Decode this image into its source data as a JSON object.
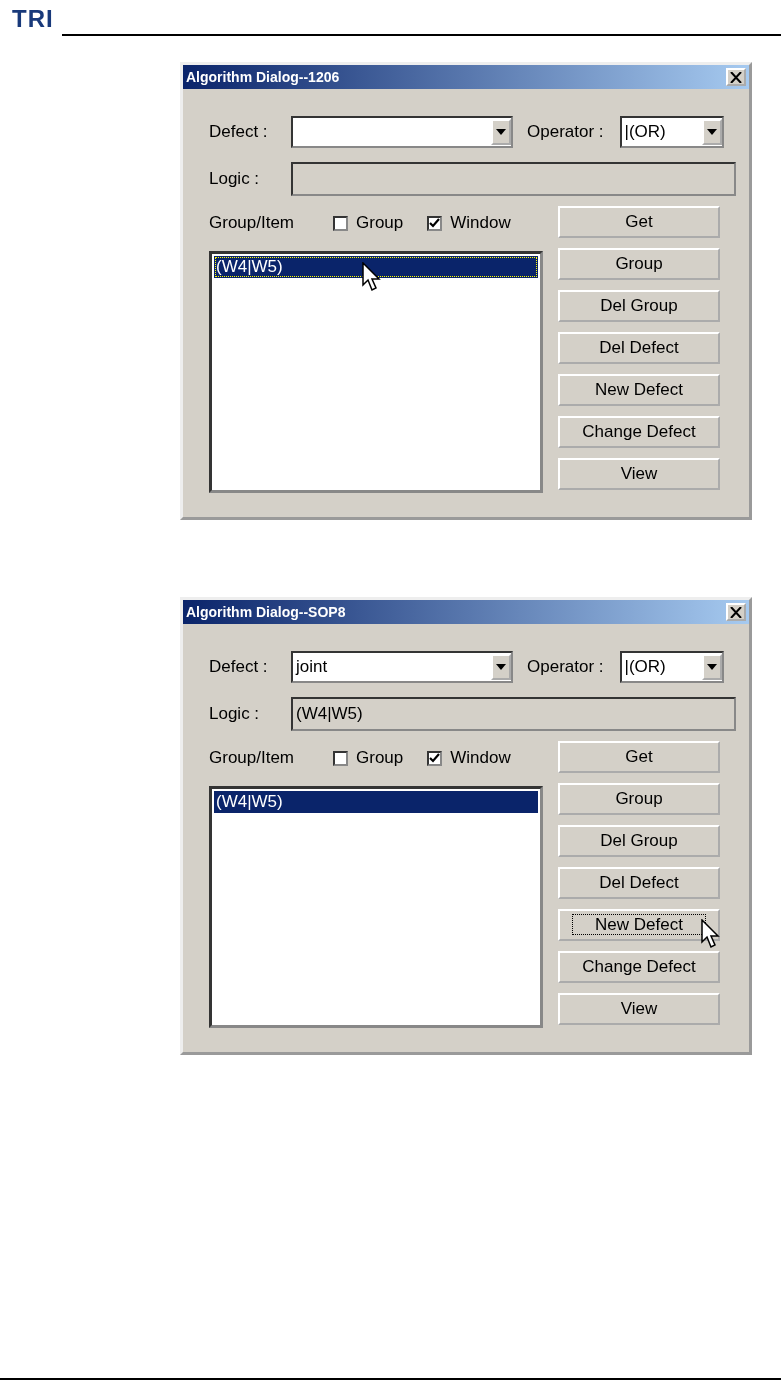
{
  "header": {
    "logo": "TRI"
  },
  "dialogs": [
    {
      "title": "Algorithm Dialog--1206",
      "defect": {
        "label": "Defect :"
      },
      "operator": {
        "label": "Operator :",
        "value": "|(OR)"
      },
      "logic": {
        "label": "Logic :"
      },
      "group_item_label": "Group/Item",
      "checkboxes": [
        {
          "label": "Group",
          "checked": false
        },
        {
          "label": "Window",
          "checked": true
        }
      ],
      "list": [
        {
          "text": "(W4|W5)",
          "selected": true,
          "focused": true,
          "pointer": true
        }
      ],
      "buttons": [
        {
          "label": "Get",
          "focused": false,
          "pointer": false
        },
        {
          "label": "Group",
          "focused": false,
          "pointer": false
        },
        {
          "label": "Del Group",
          "focused": false,
          "pointer": false
        },
        {
          "label": "Del Defect",
          "focused": false,
          "pointer": false
        },
        {
          "label": "New Defect",
          "focused": false,
          "pointer": false
        },
        {
          "label": "Change Defect",
          "focused": false,
          "pointer": false
        },
        {
          "label": "View",
          "focused": false,
          "pointer": false
        }
      ]
    },
    {
      "title": "Algorithm Dialog--SOP8",
      "defect": {
        "label": "Defect :",
        "value": "joint"
      },
      "operator": {
        "label": "Operator :",
        "value": "|(OR)"
      },
      "logic": {
        "label": "Logic :",
        "value": "(W4|W5)"
      },
      "group_item_label": "Group/Item",
      "checkboxes": [
        {
          "label": "Group",
          "checked": false
        },
        {
          "label": "Window",
          "checked": true
        }
      ],
      "list": [
        {
          "text": "(W4|W5)",
          "selected": true,
          "focused": false,
          "pointer": false
        }
      ],
      "buttons": [
        {
          "label": "Get",
          "focused": false,
          "pointer": false
        },
        {
          "label": "Group",
          "focused": false,
          "pointer": false
        },
        {
          "label": "Del Group",
          "focused": false,
          "pointer": false
        },
        {
          "label": "Del Defect",
          "focused": false,
          "pointer": false
        },
        {
          "label": "New Defect",
          "focused": true,
          "pointer": true
        },
        {
          "label": "Change Defect",
          "focused": false,
          "pointer": false
        },
        {
          "label": "View",
          "focused": false,
          "pointer": false
        }
      ]
    }
  ]
}
